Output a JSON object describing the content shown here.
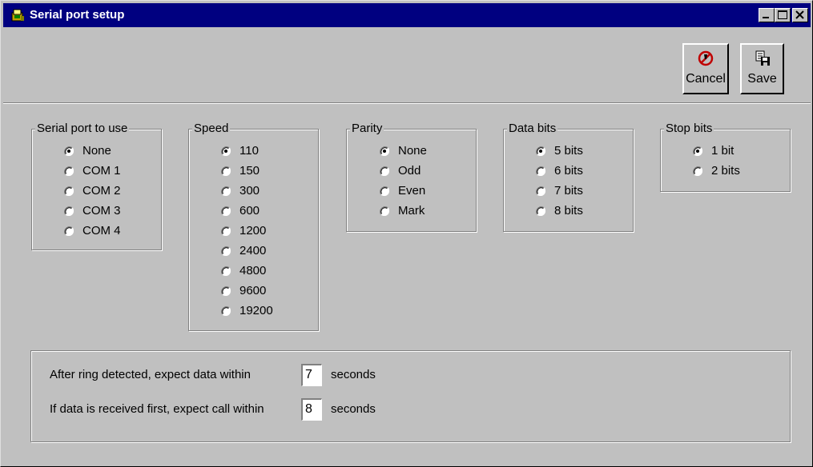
{
  "window": {
    "title": "Serial port setup"
  },
  "toolbar": {
    "cancel_label": "Cancel",
    "save_label": "Save"
  },
  "groups": {
    "port": {
      "title": "Serial port to use",
      "options": [
        "None",
        "COM 1",
        "COM 2",
        "COM 3",
        "COM 4"
      ],
      "selected": "None"
    },
    "speed": {
      "title": "Speed",
      "options": [
        "110",
        "150",
        "300",
        "600",
        "1200",
        "2400",
        "4800",
        "9600",
        "19200"
      ],
      "selected": "110"
    },
    "parity": {
      "title": "Parity",
      "options": [
        "None",
        "Odd",
        "Even",
        "Mark"
      ],
      "selected": "None"
    },
    "databits": {
      "title": "Data bits",
      "options": [
        "5 bits",
        "6 bits",
        "7 bits",
        "8 bits"
      ],
      "selected": "5 bits"
    },
    "stopbits": {
      "title": "Stop bits",
      "options": [
        "1 bit",
        "2 bits"
      ],
      "selected": "1 bit"
    }
  },
  "timeouts": {
    "ring_label": "After ring detected, expect data within",
    "ring_value": "7",
    "ring_unit": "seconds",
    "data_label": "If data is received first, expect call within",
    "data_value": "8",
    "data_unit": "seconds"
  }
}
